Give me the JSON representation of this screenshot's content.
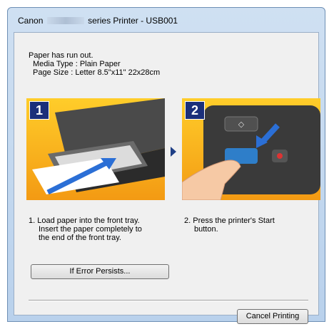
{
  "window": {
    "title_prefix": "Canon",
    "title_suffix": "series Printer - USB001"
  },
  "message": {
    "line1": "Paper has run out.",
    "media_type": "Media Type : Plain Paper",
    "page_size": "Page Size : Letter 8.5\"x11\" 22x28cm"
  },
  "steps": [
    {
      "number": "1",
      "caption_lines": [
        "1.  Load paper into the front tray.",
        "Insert the paper completely to",
        "the end of the front tray."
      ]
    },
    {
      "number": "2",
      "caption_lines": [
        "2.  Press the printer's Start",
        "button."
      ]
    }
  ],
  "buttons": {
    "if_error": "If Error Persists...",
    "cancel": "Cancel Printing"
  }
}
